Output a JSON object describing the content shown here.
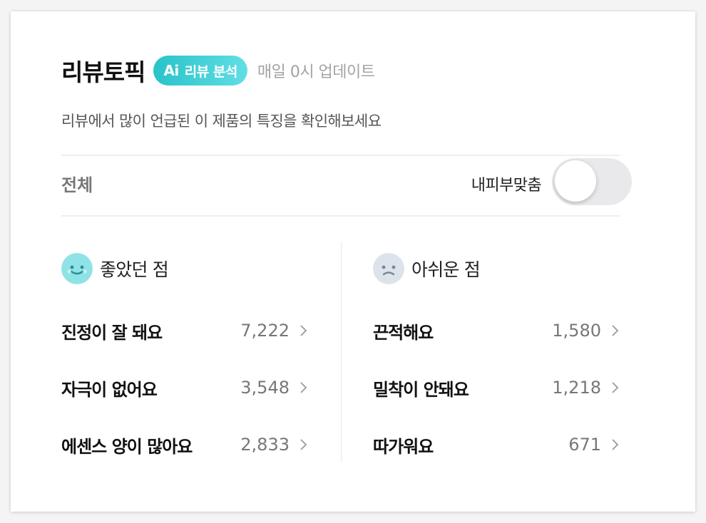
{
  "header": {
    "title": "리뷰토픽",
    "ai_badge_prefix": "Ai",
    "ai_badge_text": "리뷰 분석",
    "update_text": "매일 0시 업데이트"
  },
  "subtitle": "리뷰에서 많이 언급된 이 제품의 특징을 확인해보세요",
  "filter": {
    "all_label": "전체",
    "toggle_label": "내피부맞춤",
    "toggle_on": false
  },
  "good": {
    "heading": "좋았던 점",
    "icon": "smile-face-icon",
    "items": [
      {
        "label": "진정이 잘 돼요",
        "count": "7,222"
      },
      {
        "label": "자극이 없어요",
        "count": "3,548"
      },
      {
        "label": "에센스 양이 많아요",
        "count": "2,833"
      }
    ]
  },
  "bad": {
    "heading": "아쉬운 점",
    "icon": "sad-face-icon",
    "items": [
      {
        "label": "끈적해요",
        "count": "1,580"
      },
      {
        "label": "밀착이 안돼요",
        "count": "1,218"
      },
      {
        "label": "따가워요",
        "count": "671"
      }
    ]
  },
  "colors": {
    "accent_start": "#28c3c9",
    "accent_end": "#62dee5",
    "good_face": "#8fe3e6",
    "bad_face": "#dde3ea"
  }
}
